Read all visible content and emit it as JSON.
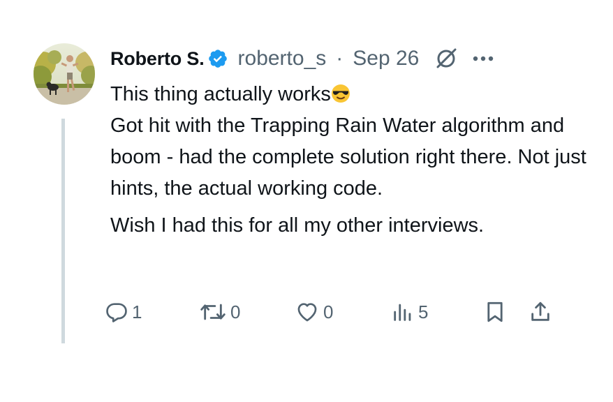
{
  "post": {
    "author_name": "Roberto S.",
    "verified": true,
    "handle": "roberto_s",
    "separator": "·",
    "date": "Sep 26",
    "text_line1": "This thing actually works",
    "text_para1_rest": "Got hit with the Trapping Rain Water algorithm and boom - had the complete solution right there. Not just hints, the actual working code.",
    "text_para2": "Wish I had this for all my other interviews.",
    "emoji": "smiling-face-with-sunglasses"
  },
  "actions": {
    "replies": "1",
    "reposts": "0",
    "likes": "0",
    "views": "5"
  },
  "icons": {
    "verified": "verified-badge-icon",
    "grok": "grok-icon",
    "more": "more-icon",
    "reply": "reply-icon",
    "repost": "repost-icon",
    "like": "like-icon",
    "views": "views-icon",
    "bookmark": "bookmark-icon",
    "share": "share-icon"
  },
  "colors": {
    "text_primary": "#0f1419",
    "text_secondary": "#536471",
    "verified_blue": "#1d9bf0",
    "thread_line": "#cfd9de"
  }
}
